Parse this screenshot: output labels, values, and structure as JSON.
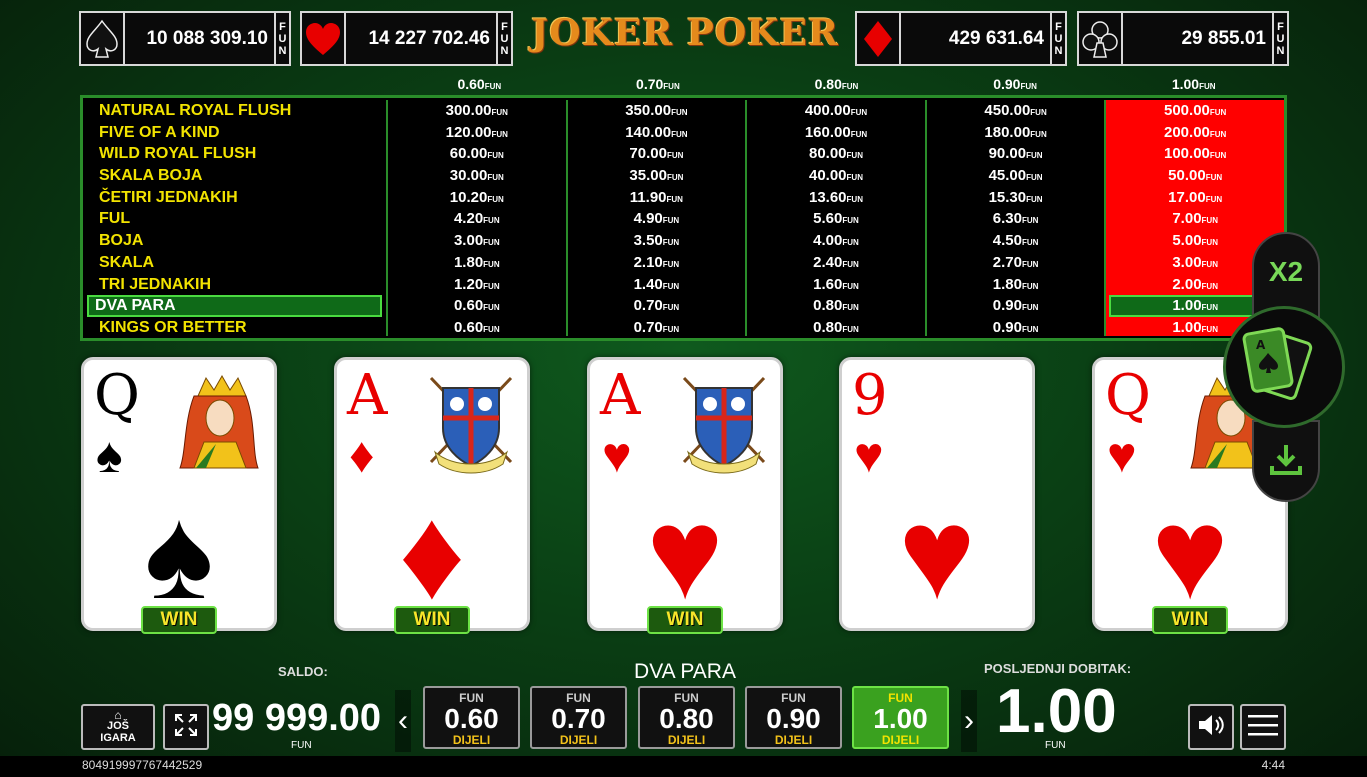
{
  "title": "JOKER POKER",
  "jackpots": [
    {
      "suit": "spade-icon",
      "value": "10 088 309.10",
      "fun": [
        "F",
        "U",
        "N"
      ]
    },
    {
      "suit": "heart-icon",
      "value": "14 227 702.46",
      "fun": [
        "F",
        "U",
        "N"
      ]
    },
    {
      "suit": "diamond-icon",
      "value": "429 631.64",
      "fun": [
        "F",
        "U",
        "N"
      ]
    },
    {
      "suit": "club-icon",
      "value": "29 855.01",
      "fun": [
        "F",
        "U",
        "N"
      ]
    }
  ],
  "paytable": {
    "currency": "FUN",
    "bets": [
      "0.60",
      "0.70",
      "0.80",
      "0.90",
      "1.00"
    ],
    "active_bet_index": 4,
    "highlight_row_index": 9,
    "hands": [
      "NATURAL ROYAL FLUSH",
      "FIVE OF A KIND",
      "WILD ROYAL FLUSH",
      "SKALA BOJA",
      "ČETIRI JEDNAKIH",
      "FUL",
      "BOJA",
      "SKALA",
      "TRI JEDNAKIH",
      "DVA PARA",
      "KINGS OR BETTER"
    ],
    "payouts": [
      [
        "300.00",
        "120.00",
        "60.00",
        "30.00",
        "10.20",
        "4.20",
        "3.00",
        "1.80",
        "1.20",
        "0.60",
        "0.60"
      ],
      [
        "350.00",
        "140.00",
        "70.00",
        "35.00",
        "11.90",
        "4.90",
        "3.50",
        "2.10",
        "1.40",
        "0.70",
        "0.70"
      ],
      [
        "400.00",
        "160.00",
        "80.00",
        "40.00",
        "13.60",
        "5.60",
        "4.00",
        "2.40",
        "1.60",
        "0.80",
        "0.80"
      ],
      [
        "450.00",
        "180.00",
        "90.00",
        "45.00",
        "15.30",
        "6.30",
        "4.50",
        "2.70",
        "1.80",
        "0.90",
        "0.90"
      ],
      [
        "500.00",
        "200.00",
        "100.00",
        "50.00",
        "17.00",
        "7.00",
        "5.00",
        "3.00",
        "2.00",
        "1.00",
        "1.00"
      ]
    ]
  },
  "cards": [
    {
      "rank": "Q",
      "suit": "spades",
      "suit_glyph": "♠",
      "color": "black",
      "face": "queen",
      "win": true
    },
    {
      "rank": "A",
      "suit": "diamonds",
      "suit_glyph": "♦",
      "color": "red",
      "face": "crest",
      "win": true
    },
    {
      "rank": "A",
      "suit": "hearts",
      "suit_glyph": "♥",
      "color": "red",
      "face": "crest",
      "win": true
    },
    {
      "rank": "9",
      "suit": "hearts",
      "suit_glyph": "♥",
      "color": "red",
      "face": "none",
      "win": false
    },
    {
      "rank": "Q",
      "suit": "hearts",
      "suit_glyph": "♥",
      "color": "red",
      "face": "queen",
      "win": true
    }
  ],
  "win_label": "WIN",
  "side": {
    "double_label": "X2",
    "cards_icon": "playing-cards-icon",
    "download_icon": "download-icon"
  },
  "bottom": {
    "saldo_label": "SALDO:",
    "balance": "99 999.00",
    "balance_unit": "FUN",
    "hand_result": "DVA PARA",
    "last_win_label": "POSLJEDNJI DOBITAK:",
    "last_win": "1.00",
    "last_win_unit": "FUN",
    "more_games": [
      "JOŠ",
      "IGARA"
    ],
    "bet_buttons": [
      {
        "fun": "FUN",
        "value": "0.60",
        "deal": "DIJELI"
      },
      {
        "fun": "FUN",
        "value": "0.70",
        "deal": "DIJELI"
      },
      {
        "fun": "FUN",
        "value": "0.80",
        "deal": "DIJELI"
      },
      {
        "fun": "FUN",
        "value": "0.90",
        "deal": "DIJELI"
      },
      {
        "fun": "FUN",
        "value": "1.00",
        "deal": "DIJELI"
      }
    ],
    "active_bet_button": 4,
    "arrow_left": "‹",
    "arrow_right": "›"
  },
  "footer": {
    "session_id": "804919997767442529",
    "clock": "4:44"
  },
  "colors": {
    "accent_green": "#3aa11f",
    "paytable_active": "#ff0000",
    "hand_text": "#f2e300",
    "title": "#e58a1c"
  }
}
